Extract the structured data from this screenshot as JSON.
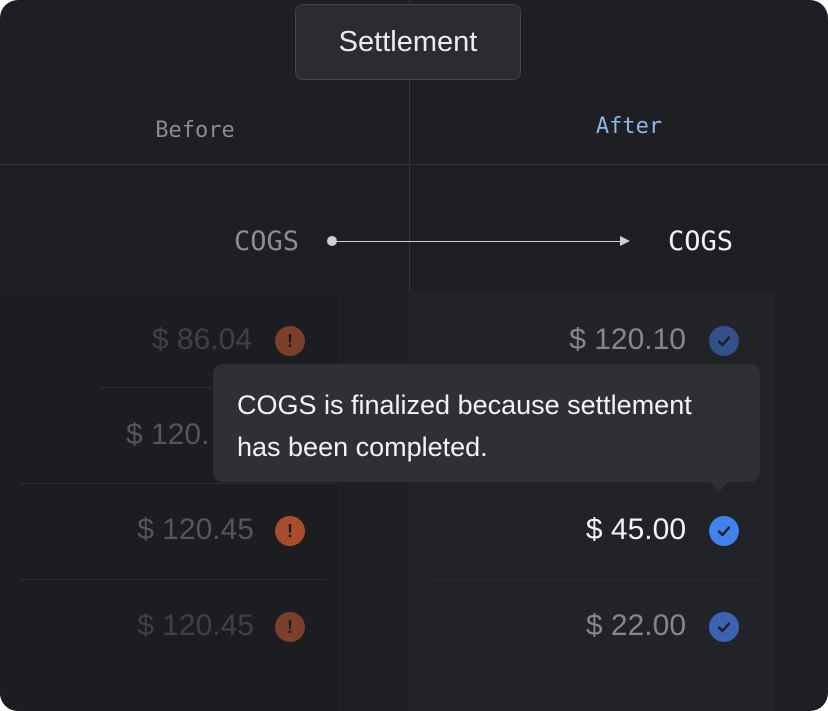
{
  "header": {
    "title": "Settlement"
  },
  "columns": {
    "before_label": "Before",
    "after_label": "After"
  },
  "field": {
    "before_label": "COGS",
    "after_label": "COGS"
  },
  "before_rows": [
    {
      "amount": "$ 86.04",
      "status_icon": "warning-icon"
    },
    {
      "amount": "$ 120.",
      "status_icon": "warning-icon"
    },
    {
      "amount": "$ 120.45",
      "status_icon": "warning-icon"
    },
    {
      "amount": "$ 120.45",
      "status_icon": "warning-icon"
    }
  ],
  "after_rows": [
    {
      "amount": "$ 120.10",
      "status_icon": "check-icon"
    },
    {
      "amount": "$ 45.00",
      "status_icon": "check-icon"
    },
    {
      "amount": "$ 22.00",
      "status_icon": "check-icon"
    }
  ],
  "tooltip": {
    "line1": "COGS is finalized because settlement",
    "line2": "has been completed."
  },
  "colors": {
    "background": "#1e1f22",
    "accent_blue": "#3f82f0",
    "warning_orange": "#a84d2c",
    "after_label": "#8fb4e8"
  }
}
